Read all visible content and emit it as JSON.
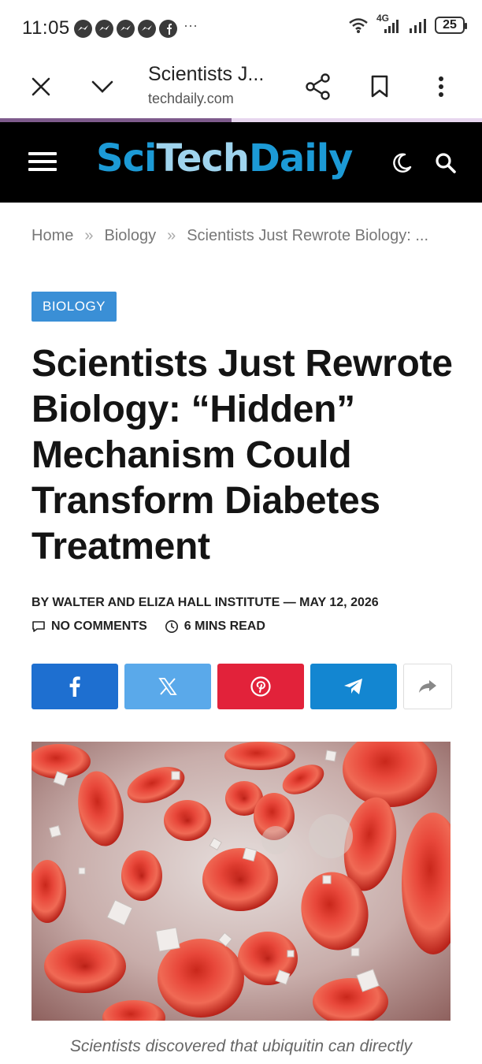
{
  "status_bar": {
    "time": "11:05",
    "notification_icons": [
      "messenger-icon",
      "messenger-icon",
      "messenger-icon",
      "messenger-icon",
      "facebook-icon"
    ],
    "more": "···",
    "network": "4G",
    "battery": "25"
  },
  "browser": {
    "tab_title": "Scientists J...",
    "url": "techdaily.com",
    "load_progress_fraction": 0.48
  },
  "site": {
    "logo_sci": "Sci",
    "logo_tech": "Tech",
    "logo_daily": "Daily"
  },
  "breadcrumb": {
    "home": "Home",
    "separator": "»",
    "section": "Biology",
    "current": "Scientists Just Rewrote Biology: ..."
  },
  "article": {
    "category": "BIOLOGY",
    "title": "Scientists Just Rewrote Biology: “Hidden” Mechanism Could Transform Diabetes Treatment",
    "byline": "BY WALTER AND ELIZA HALL INSTITUTE — MAY 12, 2026",
    "comments": "NO COMMENTS",
    "read_time": "6 MINS READ",
    "caption": "Scientists discovered that ubiquitin can directly"
  },
  "colors": {
    "tag_blue": "#3a8fd6",
    "facebook": "#1e6fd0",
    "x": "#5aa9ea",
    "pinterest": "#e2223a",
    "telegram": "#1386d1",
    "logo_blue": "#1c9ad6"
  }
}
